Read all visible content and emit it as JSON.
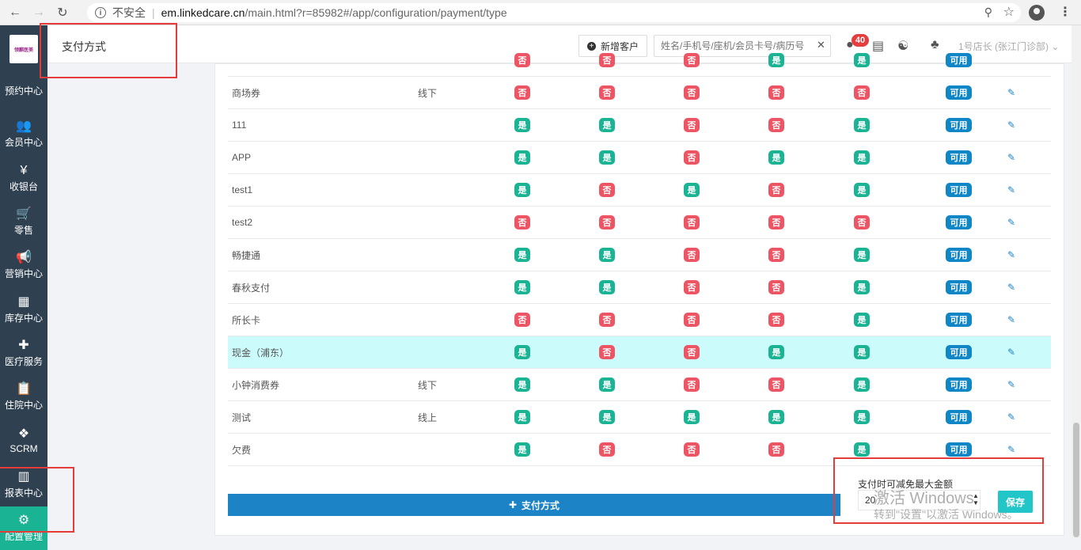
{
  "browser": {
    "security_text": "不安全",
    "host": "em.linkedcare.cn",
    "path": "/main.html?r=85982#/app/configuration/payment/type"
  },
  "sidebar": {
    "logo_text": "领麒医美",
    "items": [
      {
        "label": "预约中心",
        "icon": "calendar-icon"
      },
      {
        "label": "会员中心",
        "icon": "users-icon"
      },
      {
        "label": "收银台",
        "icon": "yen-icon"
      },
      {
        "label": "零售",
        "icon": "cart-icon"
      },
      {
        "label": "营销中心",
        "icon": "megaphone-icon"
      },
      {
        "label": "库存中心",
        "icon": "grid-icon"
      },
      {
        "label": "医疗服务",
        "icon": "medkit-icon"
      },
      {
        "label": "住院中心",
        "icon": "clipboard-icon"
      },
      {
        "label": "SCRM",
        "icon": "cubes-icon"
      },
      {
        "label": "报表中心",
        "icon": "bar-chart-icon"
      },
      {
        "label": "配置管理",
        "icon": "gear-icon"
      }
    ]
  },
  "header": {
    "title": "支付方式",
    "new_customer_label": "新增客户",
    "search_placeholder": "姓名/手机号/座机/会员卡号/病历号",
    "notification_count": "40",
    "user_label": "1号店长 (张江门诊部)"
  },
  "table": {
    "rows": [
      {
        "name": "商场券",
        "type": "线下",
        "flags": [
          "否",
          "否",
          "否",
          "否",
          "否"
        ],
        "status": "可用"
      },
      {
        "name": "111",
        "type": "",
        "flags": [
          "是",
          "是",
          "否",
          "否",
          "是"
        ],
        "status": "可用"
      },
      {
        "name": "APP",
        "type": "",
        "flags": [
          "是",
          "是",
          "否",
          "是",
          "是"
        ],
        "status": "可用"
      },
      {
        "name": "test1",
        "type": "",
        "flags": [
          "是",
          "否",
          "是",
          "否",
          "是"
        ],
        "status": "可用"
      },
      {
        "name": "test2",
        "type": "",
        "flags": [
          "否",
          "否",
          "否",
          "否",
          "否"
        ],
        "status": "可用"
      },
      {
        "name": "畅捷通",
        "type": "",
        "flags": [
          "是",
          "是",
          "否",
          "否",
          "是"
        ],
        "status": "可用"
      },
      {
        "name": "春秋支付",
        "type": "",
        "flags": [
          "是",
          "是",
          "否",
          "否",
          "是"
        ],
        "status": "可用"
      },
      {
        "name": "所长卡",
        "type": "",
        "flags": [
          "否",
          "否",
          "否",
          "否",
          "是"
        ],
        "status": "可用"
      },
      {
        "name": "现金（浦东）",
        "type": "",
        "flags": [
          "是",
          "否",
          "否",
          "是",
          "是"
        ],
        "status": "可用"
      },
      {
        "name": "小钟消费券",
        "type": "线下",
        "flags": [
          "是",
          "是",
          "否",
          "否",
          "是"
        ],
        "status": "可用"
      },
      {
        "name": "测试",
        "type": "线上",
        "flags": [
          "是",
          "是",
          "是",
          "是",
          "是"
        ],
        "status": "可用"
      },
      {
        "name": "欠费",
        "type": "",
        "flags": [
          "是",
          "否",
          "否",
          "否",
          "是"
        ],
        "status": "可用"
      }
    ],
    "partial_top_row_flags": [
      "否",
      "否",
      "否",
      "是",
      "是"
    ],
    "partial_top_row_status": "可用"
  },
  "footer": {
    "add_payment_label": "支付方式",
    "limit_label": "支付时可减免最大金额",
    "limit_value": "20",
    "save_label": "保存"
  },
  "watermark": {
    "line1": "激活 Windows",
    "line2": "转到\"设置\"以激活 Windows。"
  },
  "colors": {
    "yes": "#1ab394",
    "no": "#ed5565",
    "status": "#0f86c6",
    "sidebar_bg": "#2f4050",
    "sidebar_active": "#1ab394",
    "primary_button": "#1c84c6",
    "save_button": "#23c6c8",
    "highlight_row": "#ccfbfb",
    "annotation": "#e53b3b"
  }
}
